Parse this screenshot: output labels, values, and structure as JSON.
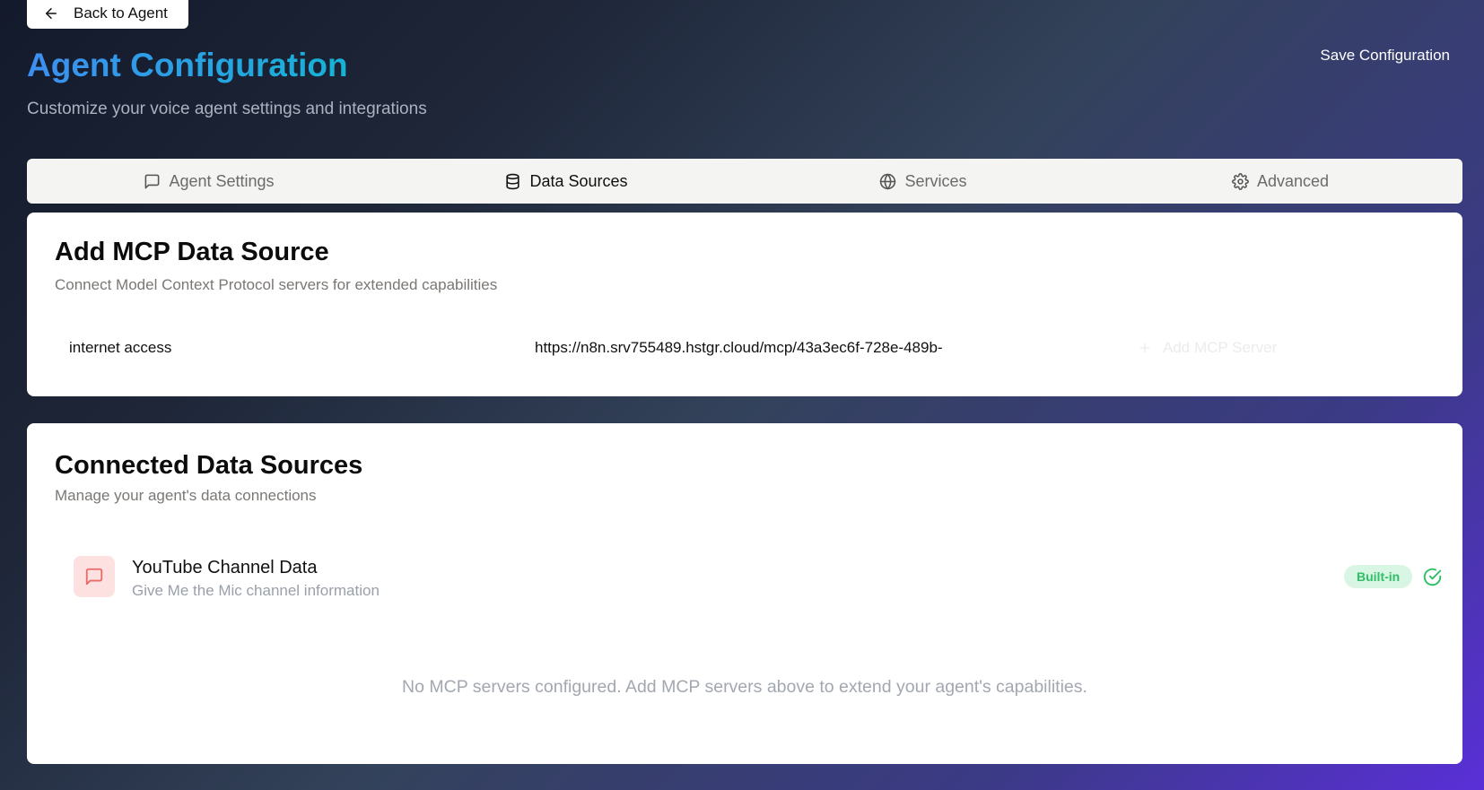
{
  "header": {
    "back_label": "Back to Agent",
    "title": "Agent Configuration",
    "subtitle": "Customize your voice agent settings and integrations",
    "save_label": "Save Configuration"
  },
  "tabs": [
    {
      "label": "Agent Settings",
      "icon": "message-square-icon",
      "active": false
    },
    {
      "label": "Data Sources",
      "icon": "database-icon",
      "active": true
    },
    {
      "label": "Services",
      "icon": "globe-icon",
      "active": false
    },
    {
      "label": "Advanced",
      "icon": "settings-gear-icon",
      "active": false
    }
  ],
  "add_mcp": {
    "title": "Add MCP Data Source",
    "description": "Connect Model Context Protocol servers for extended capabilities",
    "name_value": "internet access",
    "url_value": "https://n8n.srv755489.hstgr.cloud/mcp/43a3ec6f-728e-489b-",
    "add_button_label": "Add MCP Server"
  },
  "connected": {
    "title": "Connected Data Sources",
    "description": "Manage your agent's data connections",
    "sources": [
      {
        "name": "YouTube Channel Data",
        "description": "Give Me the Mic channel information",
        "badge": "Built-in",
        "icon": "message-square-icon",
        "status_icon": "check-circle-icon"
      }
    ],
    "empty_message": "No MCP servers configured. Add MCP servers above to extend your agent's capabilities."
  },
  "colors": {
    "accent_blue": "#3d8ff0",
    "accent_cyan": "#16b3d6",
    "badge_bg": "#d9f5e3",
    "badge_text": "#2fc067",
    "source_icon_bg": "#fde0e0",
    "source_icon_stroke": "#e66b6b"
  }
}
